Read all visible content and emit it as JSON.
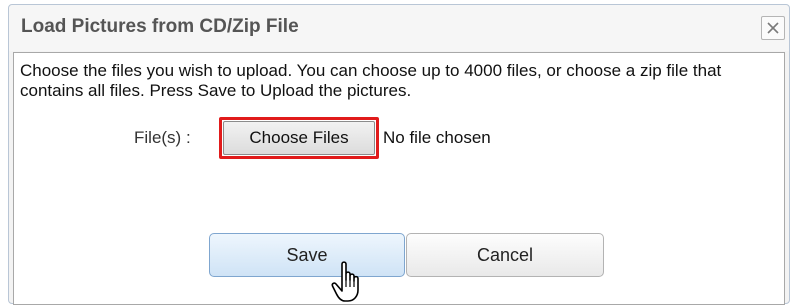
{
  "dialog": {
    "title": "Load Pictures from CD/Zip File",
    "close_icon": "close-icon",
    "instructions": "Choose the files you wish to upload. You can choose up to 4000 files, or choose a zip file that contains all files. Press Save to Upload the pictures.",
    "file_field": {
      "label": "File(s) :",
      "button_label": "Choose Files",
      "status": "No file chosen"
    },
    "buttons": {
      "save_label": "Save",
      "cancel_label": "Cancel"
    },
    "pointer_icon": "hand-pointer-icon",
    "colors": {
      "highlight": "#e11b1b",
      "save_button_border": "#7fa6cf",
      "title_text": "#555555"
    }
  }
}
